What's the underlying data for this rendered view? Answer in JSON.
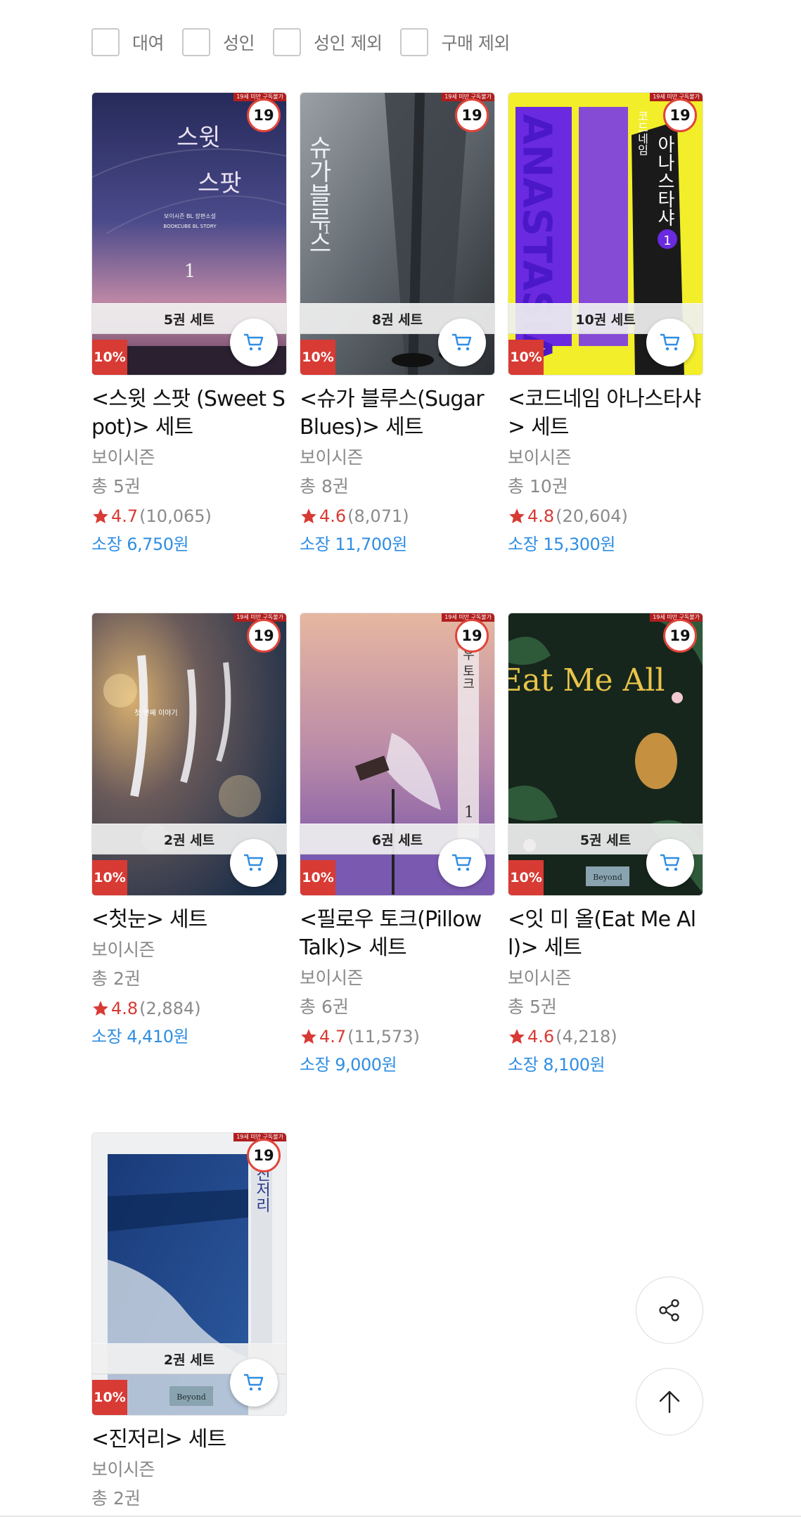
{
  "filters": [
    {
      "label": "대여",
      "checked": false
    },
    {
      "label": "성인",
      "checked": false
    },
    {
      "label": "성인 제외",
      "checked": false
    },
    {
      "label": "구매 제외",
      "checked": false
    }
  ],
  "books": [
    {
      "title": "<스윗 스팟 (Sweet Spot)> 세트",
      "author": "보이시즌",
      "count": "총 5권",
      "score": "4.7",
      "reviews": "(10,065)",
      "price": "소장 6,750원",
      "set": "5권 세트",
      "discount": "10%",
      "age": "19",
      "age_strip": "19세 미만 구독불가"
    },
    {
      "title": "<슈가 블루스(Sugar Blues)> 세트",
      "author": "보이시즌",
      "count": "총 8권",
      "score": "4.6",
      "reviews": "(8,071)",
      "price": "소장 11,700원",
      "set": "8권 세트",
      "discount": "10%",
      "age": "19",
      "age_strip": "19세 미만 구독불가"
    },
    {
      "title": "<코드네임 아나스타샤> 세트",
      "author": "보이시즌",
      "count": "총 10권",
      "score": "4.8",
      "reviews": "(20,604)",
      "price": "소장 15,300원",
      "set": "10권 세트",
      "discount": "10%",
      "age": "19",
      "age_strip": "19세 미만 구독불가"
    },
    {
      "title": "<첫눈> 세트",
      "author": "보이시즌",
      "count": "총 2권",
      "score": "4.8",
      "reviews": "(2,884)",
      "price": "소장 4,410원",
      "set": "2권 세트",
      "discount": "10%",
      "age": "19",
      "age_strip": "19세 미만 구독불가"
    },
    {
      "title": "<필로우 토크(Pillow Talk)> 세트",
      "author": "보이시즌",
      "count": "총 6권",
      "score": "4.7",
      "reviews": "(11,573)",
      "price": "소장 9,000원",
      "set": "6권 세트",
      "discount": "10%",
      "age": "19",
      "age_strip": "19세 미만 구독불가"
    },
    {
      "title": "<잇 미 올(Eat Me All)> 세트",
      "author": "보이시즌",
      "count": "총 5권",
      "score": "4.6",
      "reviews": "(4,218)",
      "price": "소장 8,100원",
      "set": "5권 세트",
      "discount": "10%",
      "age": "19",
      "age_strip": "19세 미만 구독불가"
    },
    {
      "title": "<진저리> 세트",
      "author": "보이시즌",
      "count": "총 2권",
      "score": "",
      "reviews": "",
      "price": "",
      "set": "2권 세트",
      "discount": "10%",
      "age": "19",
      "age_strip": "19세 미만 구독불가"
    }
  ],
  "cover_texts": {
    "c1_line1": "스윗",
    "c1_line2": "스팟",
    "c1_sub": "보이시즌 BL 장편소설",
    "c1_brand": "BOOKCUBE BL STORY",
    "c1_vol": "1",
    "c2_title": "슈가블루스",
    "c2_vol": "1",
    "c3_big": "ANASTASIA",
    "c3_label": "코드네임",
    "c3_title": "아나스타샤",
    "c3_vol": "1",
    "c4_author": "첫 번째 이야기",
    "c5_title": "로우 토크",
    "c5_vol": "1",
    "c6_title": "Eat Me All",
    "c6_brand": "Beyond",
    "c7_title": "진저리",
    "c7_brand": "Beyond"
  },
  "colors": {
    "accent_red": "#d83a34",
    "price_blue": "#2f8ee3",
    "muted_gray": "#8a8a8a"
  },
  "icons": [
    "checkbox",
    "cart-icon",
    "star-icon",
    "share-icon",
    "arrow-up-icon"
  ]
}
